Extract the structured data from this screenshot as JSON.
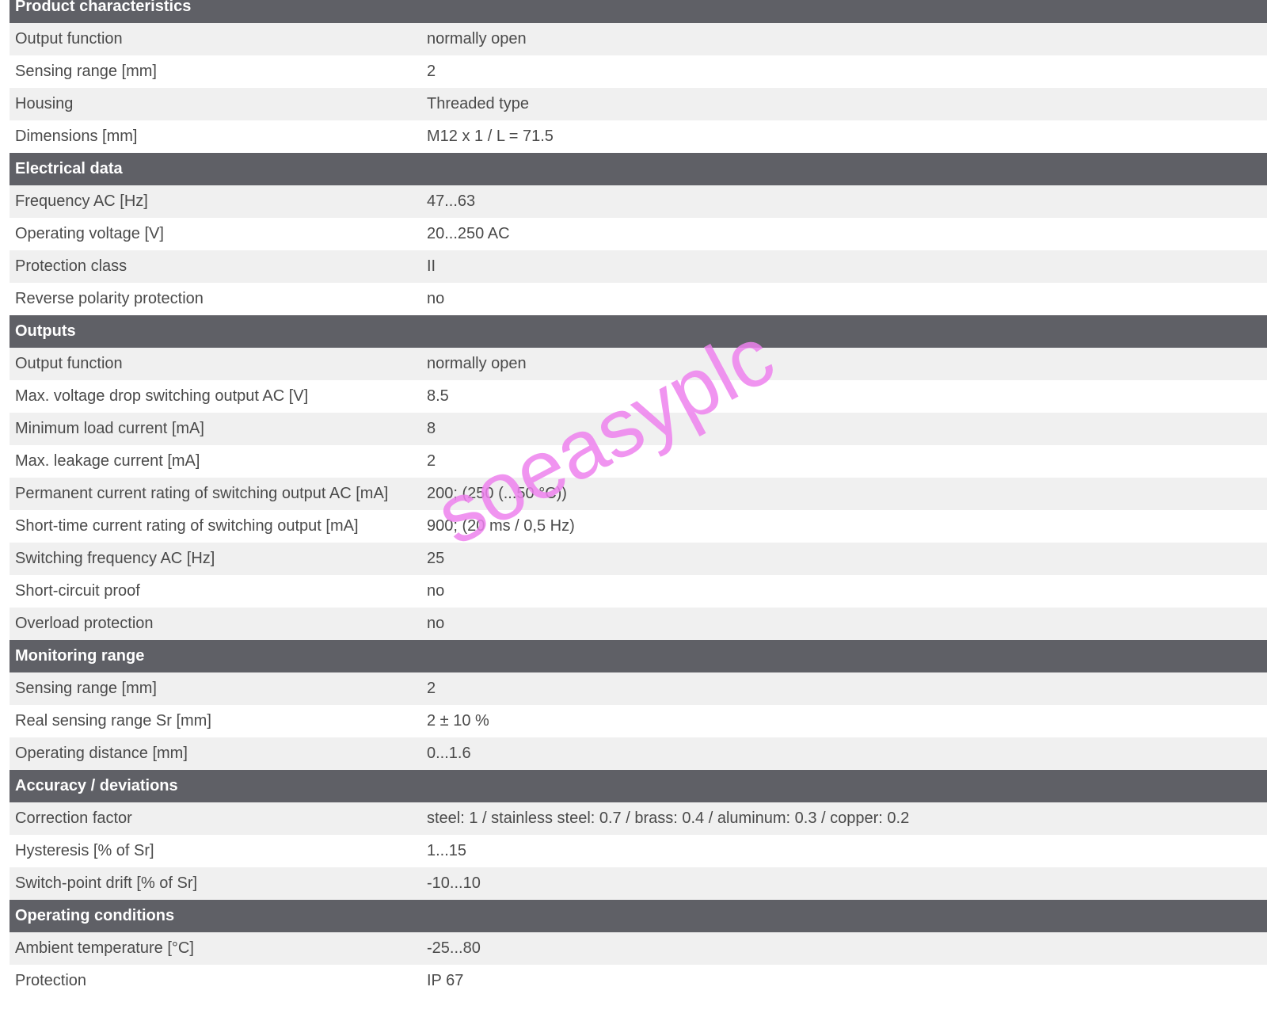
{
  "sections": [
    {
      "title": "Product characteristics",
      "rows": [
        {
          "label": "Output function",
          "value": "normally open"
        },
        {
          "label": "Sensing range [mm]",
          "value": "2"
        },
        {
          "label": "Housing",
          "value": "Threaded type"
        },
        {
          "label": "Dimensions [mm]",
          "value": "M12 x 1 / L = 71.5"
        }
      ]
    },
    {
      "title": "Electrical data",
      "rows": [
        {
          "label": "Frequency AC [Hz]",
          "value": "47...63"
        },
        {
          "label": "Operating voltage [V]",
          "value": "20...250 AC"
        },
        {
          "label": "Protection class",
          "value": "II"
        },
        {
          "label": "Reverse polarity protection",
          "value": "no"
        }
      ]
    },
    {
      "title": "Outputs",
      "rows": [
        {
          "label": "Output function",
          "value": "normally open"
        },
        {
          "label": "Max. voltage drop switching output AC [V]",
          "value": "8.5"
        },
        {
          "label": "Minimum load current [mA]",
          "value": "8"
        },
        {
          "label": "Max. leakage current [mA]",
          "value": "2"
        },
        {
          "label": "Permanent current rating of switching output AC [mA]",
          "value": "200; (250 (...50 °C))"
        },
        {
          "label": "Short-time current rating of switching output [mA]",
          "value": "900; (20 ms / 0,5 Hz)"
        },
        {
          "label": "Switching frequency AC [Hz]",
          "value": "25"
        },
        {
          "label": "Short-circuit proof",
          "value": "no"
        },
        {
          "label": "Overload protection",
          "value": "no"
        }
      ]
    },
    {
      "title": "Monitoring range",
      "rows": [
        {
          "label": "Sensing range [mm]",
          "value": "2"
        },
        {
          "label": "Real sensing range Sr [mm]",
          "value": "2 ± 10 %"
        },
        {
          "label": "Operating distance [mm]",
          "value": "0...1.6"
        }
      ]
    },
    {
      "title": "Accuracy / deviations",
      "rows": [
        {
          "label": "Correction factor",
          "value": "steel: 1 / stainless steel: 0.7 / brass: 0.4 / aluminum: 0.3 / copper: 0.2"
        },
        {
          "label": "Hysteresis [% of Sr]",
          "value": "1...15"
        },
        {
          "label": "Switch-point drift [% of Sr]",
          "value": "-10...10"
        }
      ]
    },
    {
      "title": "Operating conditions",
      "rows": [
        {
          "label": "Ambient temperature [°C]",
          "value": "-25...80"
        },
        {
          "label": "Protection",
          "value": "IP 67"
        }
      ]
    }
  ],
  "watermark": {
    "text": "soeasyplc"
  }
}
